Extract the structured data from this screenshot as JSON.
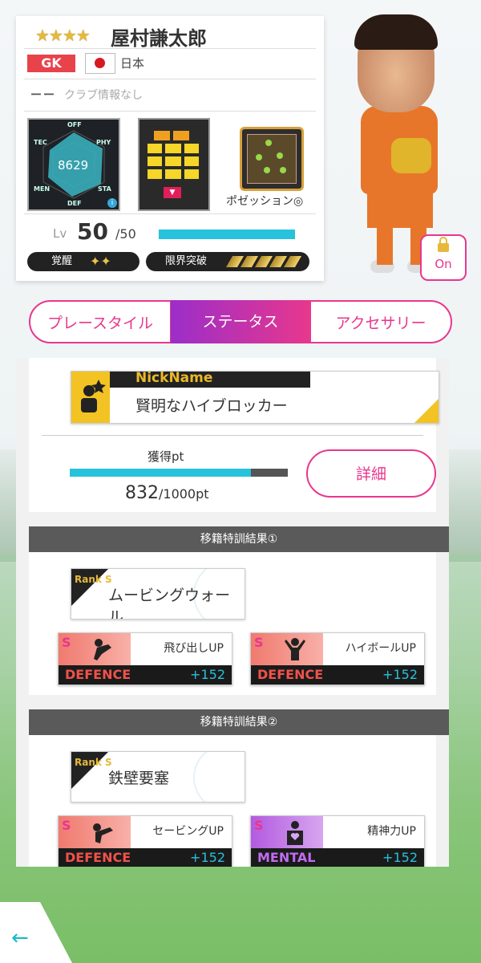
{
  "player": {
    "stars": "★★★★",
    "name": "屋村謙太郎",
    "position": "GK",
    "country": "日本",
    "club_dash": "ーー",
    "club": "クラブ情報なし",
    "total_power": "8629",
    "radar_labels": {
      "off": "OFF",
      "tec": "TEC",
      "phy": "PHY",
      "men": "MEN",
      "sta": "STA",
      "def": "DEF"
    },
    "skill_name": "ポゼッション◎",
    "level_label": "Lv",
    "level": "50",
    "level_max": "/50",
    "level_fill": 1.0,
    "awaken_label": "覚醒",
    "awaken_icons": "✦✦",
    "limit_label": "限界突破"
  },
  "lock": {
    "label": "On"
  },
  "tabs": [
    {
      "label": "プレースタイル",
      "active": false
    },
    {
      "label": "ステータス",
      "active": true
    },
    {
      "label": "アクセサリー",
      "active": false
    }
  ],
  "nickname": {
    "header": "NickName",
    "value": "賢明なハイブロッカー"
  },
  "points": {
    "label": "獲得pt",
    "current": "832",
    "max": "/1000pt",
    "fill": 0.832,
    "detail_button": "詳細"
  },
  "transfer1": {
    "header": "移籍特訓結果①",
    "rank_badge": "Rank S",
    "skill": "ムービングウォール",
    "cards": [
      {
        "grade": "S",
        "label": "飛び出しUP",
        "category": "DEFENCE",
        "value": "+152"
      },
      {
        "grade": "S",
        "label": "ハイボールUP",
        "category": "DEFENCE",
        "value": "+152"
      }
    ]
  },
  "transfer2": {
    "header": "移籍特訓結果②",
    "rank_badge": "Rank S",
    "skill": "鉄壁要塞",
    "cards": [
      {
        "grade": "S",
        "label": "セービングUP",
        "category": "DEFENCE",
        "value": "+152"
      },
      {
        "grade": "S",
        "label": "精神力UP",
        "category": "MENTAL",
        "value": "+152"
      }
    ]
  },
  "back_icon": "←",
  "colors": {
    "accent": "#e8378d",
    "cyan": "#27c2dc",
    "defence": "#e8433a",
    "mental": "#b25ae0"
  }
}
